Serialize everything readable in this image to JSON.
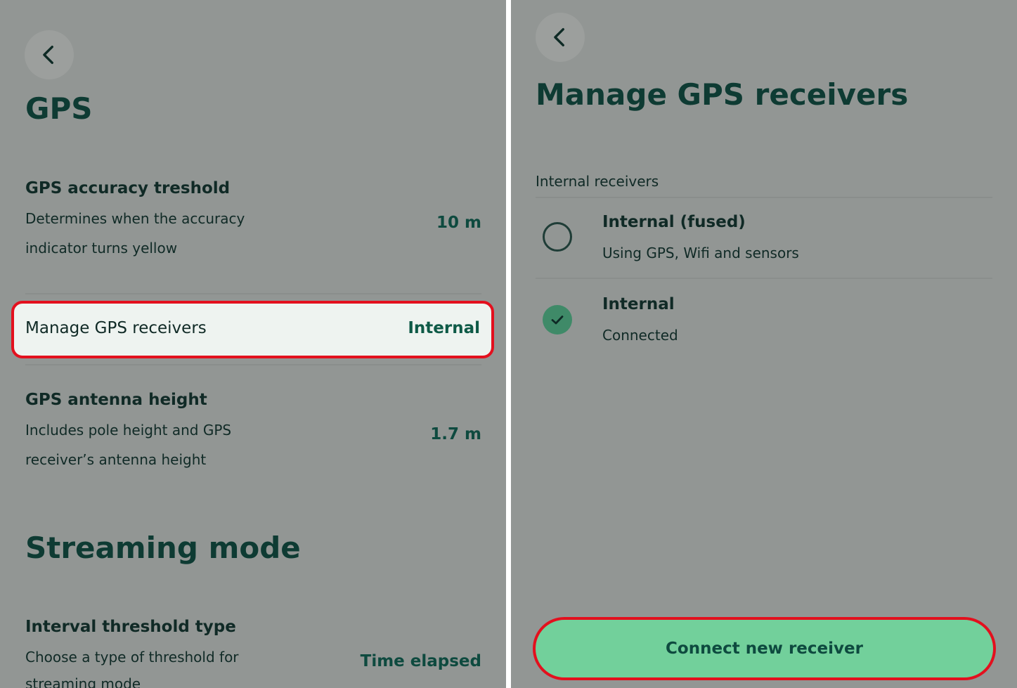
{
  "left_screen": {
    "title": "GPS",
    "settings": [
      {
        "title": "GPS accuracy treshold",
        "desc_line1": "Determines when the accuracy",
        "desc_line2": "indicator turns yellow",
        "value": "10 m"
      },
      {
        "title": "Manage GPS receivers",
        "value": "Internal"
      },
      {
        "title": "GPS antenna height",
        "desc_line1": "Includes pole height and GPS",
        "desc_line2": "receiver’s antenna height",
        "value": "1.7 m"
      }
    ],
    "section_title": "Streaming mode",
    "streaming": {
      "title": "Interval threshold type",
      "desc_line1": "Choose a type of threshold for",
      "desc_line2": "streaming mode",
      "value": "Time elapsed"
    }
  },
  "right_screen": {
    "title": "Manage GPS receivers",
    "group_label": "Internal receivers",
    "receivers": [
      {
        "title": "Internal (fused)",
        "subtitle": "Using GPS, Wifi and sensors",
        "selected": false
      },
      {
        "title": "Internal",
        "subtitle": "Connected",
        "selected": true
      }
    ],
    "connect_button": "Connect new receiver"
  },
  "icons": {
    "back": "chevron-left-icon",
    "check": "check-icon"
  },
  "colors": {
    "background": "#929694",
    "accent_text": "#0e4a3f",
    "button": "#72d09b",
    "highlight_border": "#e3101e",
    "checked": "#3f8a68"
  }
}
